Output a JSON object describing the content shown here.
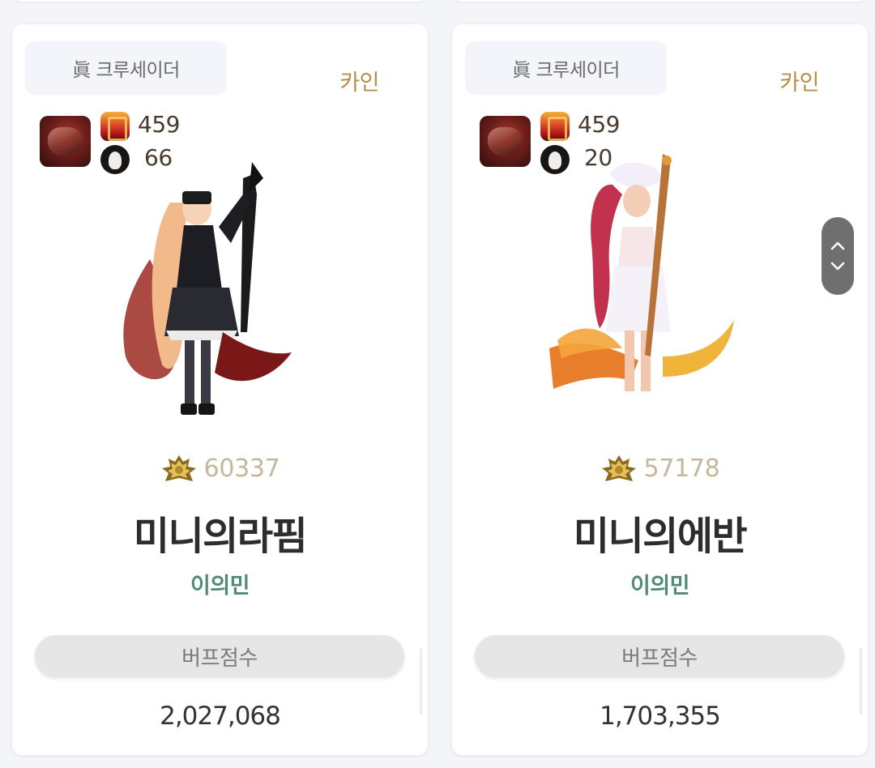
{
  "cards": [
    {
      "job": "眞 크루세이더",
      "server": "카인",
      "fame": "459",
      "buff_level": "66",
      "rank": "60337",
      "character_name": "미니의라핌",
      "adventure_name": "이의민",
      "buff_label": "버프점수",
      "buff_score": "2,027,068"
    },
    {
      "job": "眞 크루세이더",
      "server": "카인",
      "fame": "459",
      "buff_level": "20",
      "rank": "57178",
      "character_name": "미니의에반",
      "adventure_name": "이의민",
      "buff_label": "버프점수",
      "buff_score": "1,703,355"
    }
  ],
  "scroll": {
    "up_icon": "chevron-up-icon",
    "down_icon": "chevron-down-icon"
  },
  "colors": {
    "server": "#b98c4b",
    "rank": "#c5b79d",
    "adventure": "#4e8a75",
    "name": "#2d2d2d"
  }
}
